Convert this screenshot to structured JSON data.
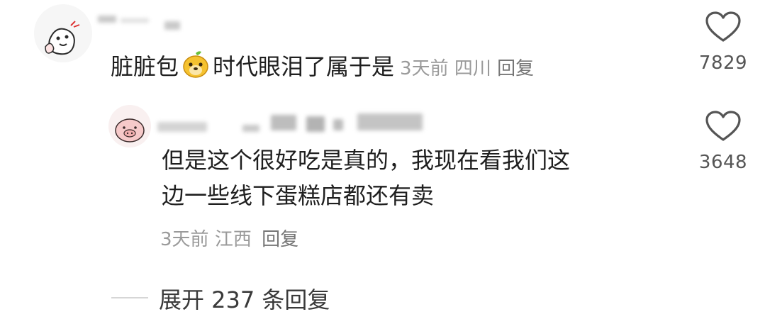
{
  "comments": [
    {
      "text_before": "脏脏包",
      "emoji": "mango-face-emoji",
      "text_after": "时代眼泪了属于是",
      "time": "3天前",
      "location": "四川",
      "reply_label": "回复",
      "likes": "7829"
    },
    {
      "lines": [
        "但是这个很好吃是真的，我现在看我们这",
        "边一些线下蛋糕店都还有卖"
      ],
      "time": "3天前",
      "location": "江西",
      "reply_label": "回复",
      "likes": "3648"
    }
  ],
  "expand_replies": "展开 237 条回复",
  "icons": {
    "like": "heart-outline-icon",
    "avatar1": "sticker-avatar",
    "avatar2": "pig-avatar"
  },
  "colors": {
    "text": "#1f1f1f",
    "meta": "#9a9a9a",
    "heart": "#555555"
  }
}
